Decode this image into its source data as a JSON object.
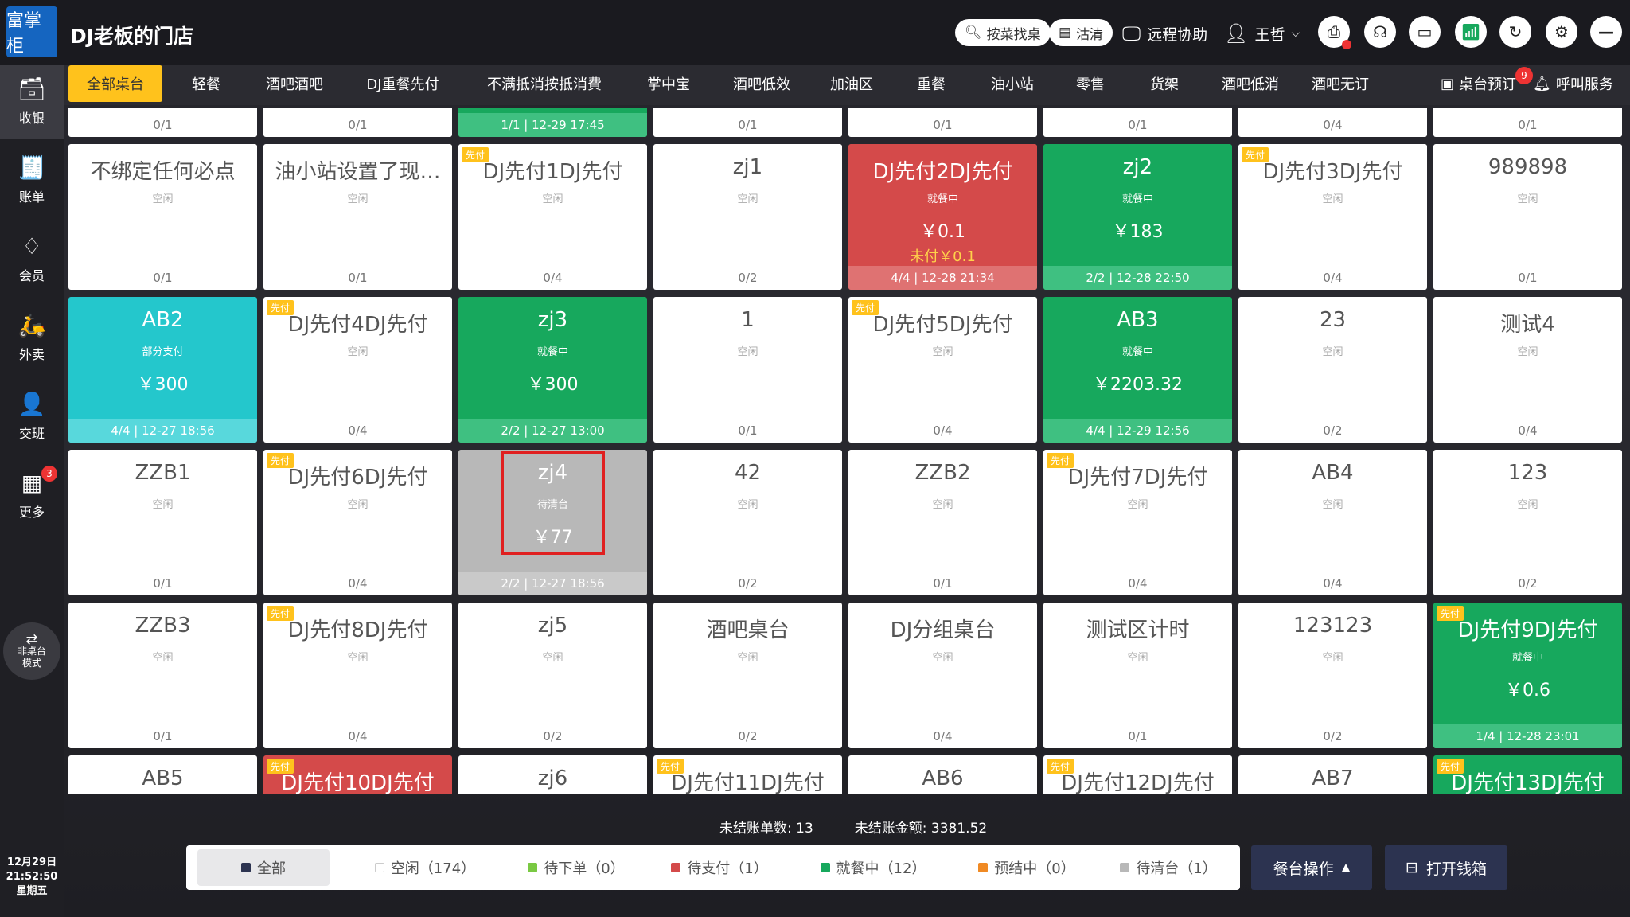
{
  "header": {
    "logo_text": "富掌柜",
    "shop_name": "DJ老板的门店",
    "search_label": "按菜找桌",
    "clean_label": "沽清",
    "remote_label": "远程协助",
    "user_name": "王哲"
  },
  "sidebar": {
    "items": [
      {
        "label": "收银",
        "icon": "cash-register-icon",
        "glyph": "🗃"
      },
      {
        "label": "账单",
        "icon": "bill-icon",
        "glyph": "🧾"
      },
      {
        "label": "会员",
        "icon": "diamond-icon",
        "glyph": "♢"
      },
      {
        "label": "外卖",
        "icon": "delivery-icon",
        "glyph": "🛵"
      },
      {
        "label": "交班",
        "icon": "user-shift-icon",
        "glyph": "👤"
      },
      {
        "label": "更多",
        "icon": "grid-icon",
        "glyph": "▦"
      }
    ],
    "more_badge": "3",
    "mode_label_1": "非桌台",
    "mode_label_2": "模式",
    "date": "12月29日",
    "time": "21:52:50",
    "weekday": "星期五"
  },
  "areas": {
    "tabs": [
      "全部桌台",
      "轻餐",
      "酒吧酒吧",
      "DJ重餐先付",
      "不满抵消按抵消費",
      "掌中宝",
      "酒吧低效",
      "加油区",
      "重餐",
      "油小站",
      "零售",
      "货架",
      "酒吧低消",
      "酒吧无订"
    ],
    "reserve_label": "桌台预订",
    "reserve_badge": "9",
    "call_label": "呼叫服务"
  },
  "tables": {
    "prepay_tag": "先付",
    "top_row_footers": [
      "0/1",
      "0/1",
      "1/1 | 12-29 17:45",
      "0/1",
      "0/1",
      "0/1",
      "0/4",
      "0/1"
    ],
    "rows": [
      [
        {
          "name": "不绑定任何必点",
          "status": "空闲",
          "footer": "0/1",
          "state": "idle",
          "prepay": false
        },
        {
          "name": "油小站设置了现…",
          "status": "空闲",
          "footer": "0/1",
          "state": "idle",
          "prepay": false
        },
        {
          "name": "DJ先付1DJ先付",
          "status": "空闲",
          "footer": "0/4",
          "state": "idle",
          "prepay": true
        },
        {
          "name": "zj1",
          "status": "空闲",
          "footer": "0/2",
          "state": "idle",
          "prepay": false
        },
        {
          "name": "DJ先付2DJ先付",
          "status": "就餐中",
          "amount": "￥0.1",
          "unpaid": "未付￥0.1",
          "footer": "4/4 | 12-28 21:34",
          "state": "unpaid",
          "prepay": false
        },
        {
          "name": "zj2",
          "status": "就餐中",
          "amount": "￥183",
          "footer": "2/2 | 12-28 22:50",
          "state": "busy",
          "prepay": false
        },
        {
          "name": "DJ先付3DJ先付",
          "status": "空闲",
          "footer": "0/4",
          "state": "idle",
          "prepay": true
        },
        {
          "name": "989898",
          "status": "空闲",
          "footer": "0/1",
          "state": "idle",
          "prepay": false
        }
      ],
      [
        {
          "name": "AB2",
          "status": "部分支付",
          "amount": "￥300",
          "footer": "4/4 | 12-27 18:56",
          "state": "partial",
          "prepay": false
        },
        {
          "name": "DJ先付4DJ先付",
          "status": "空闲",
          "footer": "0/4",
          "state": "idle",
          "prepay": true
        },
        {
          "name": "zj3",
          "status": "就餐中",
          "amount": "￥300",
          "footer": "2/2 | 12-27 13:00",
          "state": "busy",
          "prepay": false
        },
        {
          "name": "1",
          "status": "空闲",
          "footer": "0/1",
          "state": "idle",
          "prepay": false
        },
        {
          "name": "DJ先付5DJ先付",
          "status": "空闲",
          "footer": "0/4",
          "state": "idle",
          "prepay": true
        },
        {
          "name": "AB3",
          "status": "就餐中",
          "amount": "￥2203.32",
          "footer": "4/4 | 12-29 12:56",
          "state": "busy",
          "prepay": false
        },
        {
          "name": "23",
          "status": "空闲",
          "footer": "0/2",
          "state": "idle",
          "prepay": false
        },
        {
          "name": "测试4",
          "status": "空闲",
          "footer": "0/4",
          "state": "idle",
          "prepay": false
        }
      ],
      [
        {
          "name": "ZZB1",
          "status": "空闲",
          "footer": "0/1",
          "state": "idle",
          "prepay": false
        },
        {
          "name": "DJ先付6DJ先付",
          "status": "空闲",
          "footer": "0/4",
          "state": "idle",
          "prepay": true
        },
        {
          "name": "zj4",
          "status": "待清台",
          "amount": "￥77",
          "footer": "2/2 | 12-27 18:56",
          "state": "clean",
          "prepay": false
        },
        {
          "name": "42",
          "status": "空闲",
          "footer": "0/2",
          "state": "idle",
          "prepay": false
        },
        {
          "name": "ZZB2",
          "status": "空闲",
          "footer": "0/1",
          "state": "idle",
          "prepay": false
        },
        {
          "name": "DJ先付7DJ先付",
          "status": "空闲",
          "footer": "0/4",
          "state": "idle",
          "prepay": true
        },
        {
          "name": "AB4",
          "status": "空闲",
          "footer": "0/4",
          "state": "idle",
          "prepay": false
        },
        {
          "name": "123",
          "status": "空闲",
          "footer": "0/2",
          "state": "idle",
          "prepay": false
        }
      ],
      [
        {
          "name": "ZZB3",
          "status": "空闲",
          "footer": "0/1",
          "state": "idle",
          "prepay": false
        },
        {
          "name": "DJ先付8DJ先付",
          "status": "空闲",
          "footer": "0/4",
          "state": "idle",
          "prepay": true
        },
        {
          "name": "zj5",
          "status": "空闲",
          "footer": "0/2",
          "state": "idle",
          "prepay": false
        },
        {
          "name": "酒吧桌台",
          "status": "空闲",
          "footer": "0/2",
          "state": "idle",
          "prepay": false
        },
        {
          "name": "DJ分组桌台",
          "status": "空闲",
          "footer": "0/4",
          "state": "idle",
          "prepay": false
        },
        {
          "name": "测试区计时",
          "status": "空闲",
          "footer": "0/1",
          "state": "idle",
          "prepay": false
        },
        {
          "name": "123123",
          "status": "空闲",
          "footer": "0/2",
          "state": "idle",
          "prepay": false
        },
        {
          "name": "DJ先付9DJ先付",
          "status": "就餐中",
          "amount": "￥0.6",
          "footer": "1/4 | 12-28 23:01",
          "state": "busy",
          "prepay": true
        }
      ]
    ],
    "bottom_row": [
      {
        "name": "AB5",
        "state": "idle",
        "prepay": false
      },
      {
        "name": "DJ先付10DJ先付",
        "state": "unpaid",
        "prepay": true
      },
      {
        "name": "zj6",
        "state": "idle",
        "prepay": false
      },
      {
        "name": "DJ先付11DJ先付",
        "state": "idle",
        "prepay": true
      },
      {
        "name": "AB6",
        "state": "idle",
        "prepay": false
      },
      {
        "name": "DJ先付12DJ先付",
        "state": "idle",
        "prepay": true
      },
      {
        "name": "AB7",
        "state": "idle",
        "prepay": false
      },
      {
        "name": "DJ先付13DJ先付",
        "state": "busy",
        "prepay": true
      }
    ]
  },
  "summary": {
    "unsettled_count": "未结账单数: 13",
    "unsettled_amount": "未结账金额: 3381.52"
  },
  "filters": [
    {
      "label": "全部",
      "color": "#2c3350",
      "active": true
    },
    {
      "label": "空闲（174）",
      "color": "#ffffff",
      "active": false
    },
    {
      "label": "待下单（0）",
      "color": "#7ac943",
      "active": false
    },
    {
      "label": "待支付（1）",
      "color": "#d44a4a",
      "active": false
    },
    {
      "label": "就餐中（12）",
      "color": "#17a85d",
      "active": false
    },
    {
      "label": "预结中（0）",
      "color": "#f08a24",
      "active": false
    },
    {
      "label": "待清台（1）",
      "color": "#b8b8b8",
      "active": false
    }
  ],
  "actions": {
    "table_ops": "餐台操作",
    "open_drawer": "打开钱箱"
  },
  "colors": {
    "accent": "#ffc21c",
    "busy": "#17a85d",
    "unpaid": "#d44a4a",
    "partial": "#24c7cc",
    "clean": "#b8b8b8",
    "button": "#2c3350"
  }
}
